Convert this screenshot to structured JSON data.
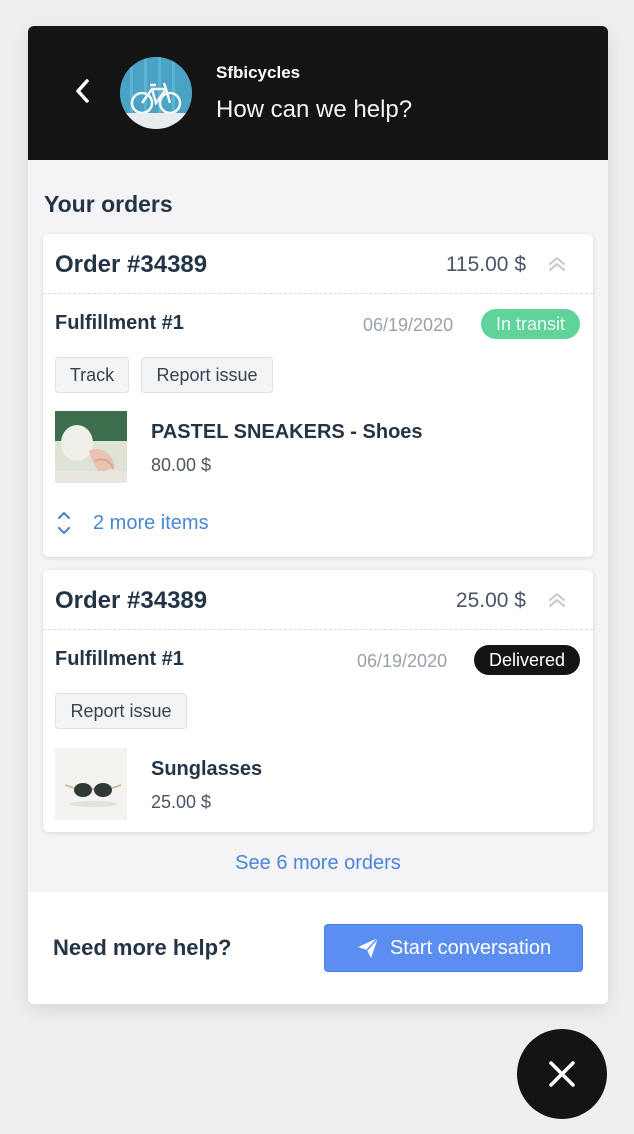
{
  "header": {
    "back_icon": "chevron-left-icon",
    "shop_name": "Sfbicycles",
    "help_text": "How can we help?"
  },
  "orders_section": {
    "title": "Your orders",
    "orders": [
      {
        "order_no": "Order #34389",
        "total": "115.00 $",
        "fulfillment": {
          "title": "Fulfillment #1",
          "date": "06/19/2020",
          "status": "In transit",
          "actions": [
            "Track",
            "Report issue"
          ]
        },
        "item": {
          "name": "PASTEL SNEAKERS - Shoes",
          "price": "80.00 $"
        },
        "more_items": "2 more items"
      },
      {
        "order_no": "Order #34389",
        "total": "25.00 $",
        "fulfillment": {
          "title": "Fulfillment #1",
          "date": "06/19/2020",
          "status": "Delivered",
          "actions": [
            "Report issue"
          ]
        },
        "item": {
          "name": "Sunglasses",
          "price": "25.00 $"
        }
      }
    ],
    "see_more": "See 6 more orders"
  },
  "footer": {
    "question": "Need more help?",
    "button_label": "Start conversation",
    "button_icon": "paper-plane-icon"
  },
  "colors": {
    "header_bg": "#141414",
    "accent_blue": "#5b8ef0",
    "link_blue": "#4a86d8",
    "in_transit_green": "#5fd39a"
  }
}
